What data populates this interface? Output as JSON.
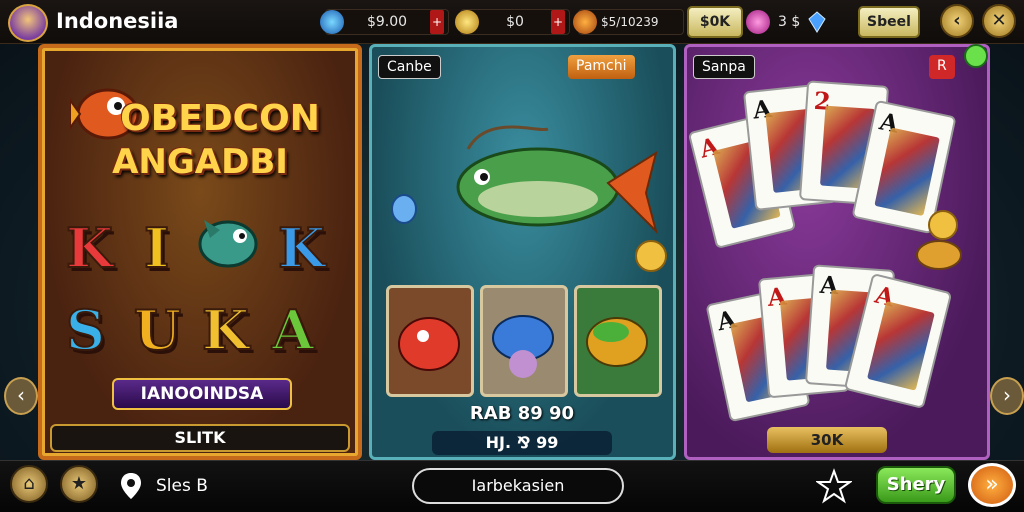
{
  "app": {
    "title": "Indonesiia"
  },
  "topbar": {
    "currency1": {
      "icon": "blue-gem-icon",
      "value": "$9.00",
      "plus": "+"
    },
    "currency2": {
      "icon": "coin-spiral-icon",
      "value": "$0",
      "plus": "+"
    },
    "currency3": {
      "icon": "gold-pot-icon",
      "value": "$5/10239",
      "button": "$0K"
    },
    "currency4": {
      "icon": "pink-gem-icon",
      "value": "3 $",
      "button": "Sbeel"
    },
    "back_icon": "back-arrow-icon",
    "close_icon": "close-x-icon"
  },
  "panels": {
    "slot": {
      "title_line1": "OBEDCON",
      "title_line2": "ANGADBI",
      "letters_row1": [
        "K",
        "I",
        "K"
      ],
      "letters_row2": [
        "S",
        "U",
        "K",
        "A"
      ],
      "name_banner": "IANOOINDSA",
      "footer_label": "SLITK"
    },
    "fishing": {
      "tag_left": "Canbe",
      "tag_right": "Pamchi",
      "tiles": [
        "red-fish-icon",
        "blue-fish-icon",
        "green-fish-icon"
      ],
      "line1": "RAB 89 90",
      "line2": "HJ. ⅋ 99"
    },
    "cards": {
      "tag_left": "Sanpa",
      "tag_right": "R",
      "bet_label": "30K"
    }
  },
  "bottombar": {
    "home_icon": "home-icon",
    "star_badge_icon": "star-badge-icon",
    "location_icon": "location-pin-icon",
    "location_label": "Sles B",
    "center_button": "Iarbekasien",
    "star_icon": "star-outline-icon",
    "share_button": "Shery",
    "next_icon": "double-chevron-right-icon"
  },
  "colors": {
    "accent_gold": "#f0c040",
    "panel_orange": "#c46a1a",
    "panel_teal": "#5ab0b8",
    "panel_purple": "#b060c0",
    "green_button": "#4cbf3a"
  }
}
